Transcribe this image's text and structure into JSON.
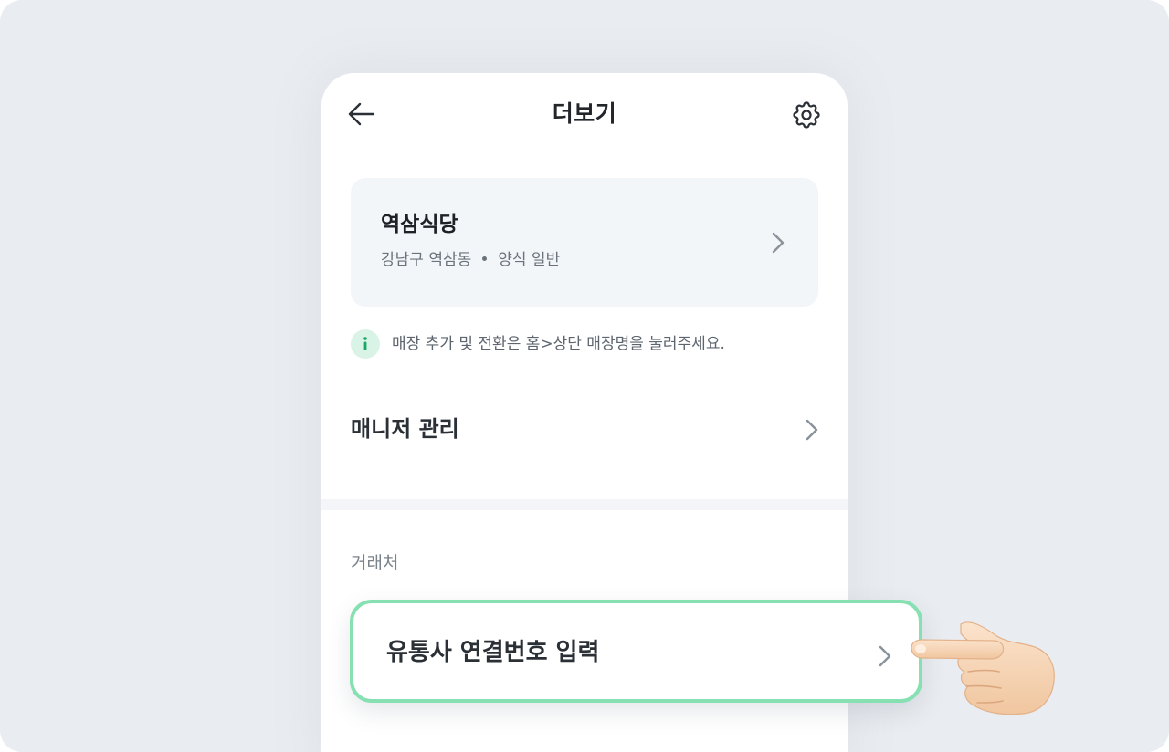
{
  "header": {
    "title": "더보기",
    "back_icon": "arrow-left-icon",
    "settings_icon": "gear-icon"
  },
  "store": {
    "name": "역삼식당",
    "district": "강남구 역삼동",
    "category": "양식 일반"
  },
  "info": {
    "icon": "info-icon",
    "text": "매장 추가 및 전환은 홈>상단 매장명을 눌러주세요."
  },
  "menu": {
    "manager_label": "매니저 관리"
  },
  "section": {
    "label": "거래처"
  },
  "callout": {
    "label": "유통사 연결번호 입력",
    "pointer_icon": "pointing-hand-icon"
  },
  "colors": {
    "background": "#e9ecf0",
    "card": "#f3f6f9",
    "accent_green": "#86e0b2",
    "info_icon_bg": "#d9f4e6",
    "info_icon_fg": "#16a864",
    "text_primary": "#22262b",
    "text_secondary": "#6a727c",
    "chevron": "#8a929b"
  }
}
